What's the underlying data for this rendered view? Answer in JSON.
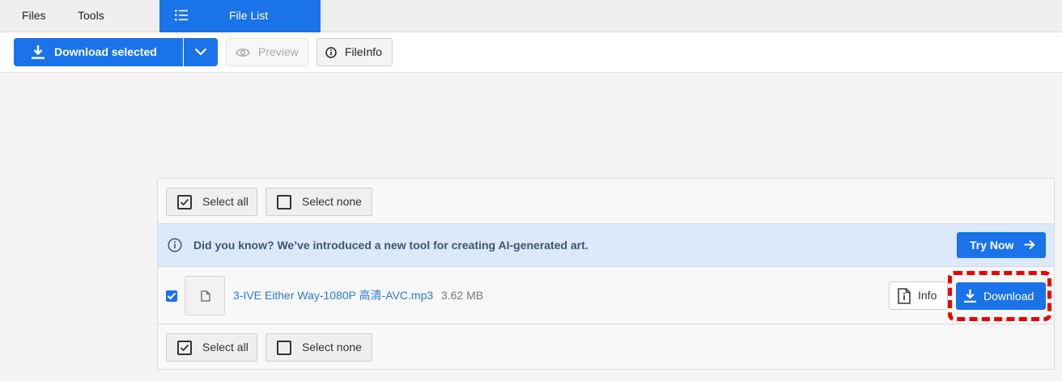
{
  "nav": {
    "files": "Files",
    "tools": "Tools",
    "active_tab": "File List",
    "active_color": "#1a73e8"
  },
  "toolbar": {
    "download_selected": "Download selected",
    "preview": "Preview",
    "fileinfo": "FileInfo"
  },
  "panel": {
    "top": {
      "select_all": "Select all",
      "select_none": "Select none"
    },
    "notice": {
      "message": "Did you know? We’ve introduced a new tool for creating AI-generated art.",
      "cta": "Try Now"
    },
    "files": [
      {
        "name": "3-IVE Either Way-1080P 高清-AVC.mp3",
        "size": "3.62 MB",
        "checked": true,
        "info_label": "Info",
        "download_label": "Download"
      }
    ],
    "bottom": {
      "select_all": "Select all",
      "select_none": "Select none"
    }
  },
  "icons": {
    "nav_list": "list-icon",
    "download": "download-icon",
    "chevron": "chevron-down-icon",
    "preview": "eye-icon",
    "fileinfo": "info-circle-icon",
    "file": "file-icon",
    "file_info": "file-info-icon",
    "arrow": "arrow-right-icon"
  },
  "highlight_color": "#ee0000"
}
